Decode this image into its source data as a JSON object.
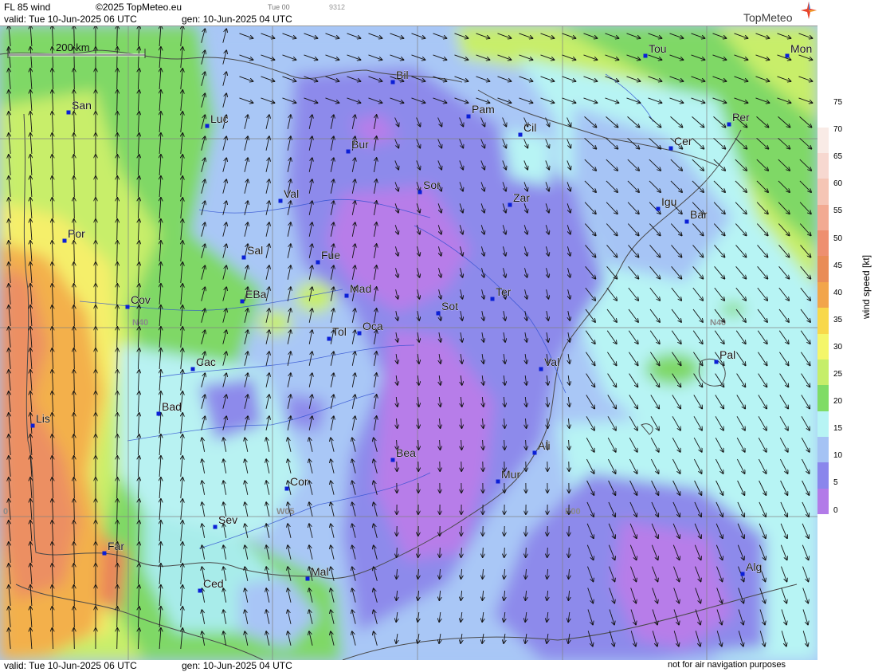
{
  "header": {
    "product": "FL 85 wind",
    "copyright": "©2025 TopMeteo.eu",
    "step_label": "Tue 00",
    "code": "9312",
    "valid": "valid:  Tue  10-Jun-2025  06 UTC",
    "generated": "gen: 10-Jun-2025 04 UTC",
    "brand": "TopMeteo"
  },
  "footer": {
    "valid": "valid:  Tue  10-Jun-2025  06 UTC",
    "generated": "gen: 10-Jun-2025 04 UTC",
    "disclaimer": "not for air navigation purposes"
  },
  "scale_bar": {
    "label": "200 km"
  },
  "grid_labels": {
    "lat_n40": "N40",
    "lon_w05": "W05",
    "lon_e00": "E00",
    "lon_w10": "0"
  },
  "legend": {
    "title": "wind speed  [kt]",
    "ticks": [
      "75",
      "70",
      "65",
      "60",
      "55",
      "50",
      "45",
      "40",
      "35",
      "30",
      "25",
      "20",
      "15",
      "10",
      "5",
      "0"
    ],
    "colors": [
      "#ffffff",
      "#ffffff",
      "#f9ebe6",
      "#f7d8d0",
      "#f5c5b5",
      "#f2aa92",
      "#ee8f6f",
      "#e98c56",
      "#f2a54a",
      "#f8d84a",
      "#f4f66a",
      "#c5ee6a",
      "#7fdc66",
      "#b7f4f4",
      "#a5c3f4",
      "#8a86ec",
      "#b27be8"
    ]
  },
  "cities": [
    {
      "name": "Bil"
    },
    {
      "name": "Tou"
    },
    {
      "name": "Mon"
    },
    {
      "name": "San"
    },
    {
      "name": "Luc"
    },
    {
      "name": "Pam"
    },
    {
      "name": "Cil"
    },
    {
      "name": "Per"
    },
    {
      "name": "Bur"
    },
    {
      "name": "Cer"
    },
    {
      "name": "Sor"
    },
    {
      "name": "Val"
    },
    {
      "name": "Zar"
    },
    {
      "name": "Igu"
    },
    {
      "name": "Bar"
    },
    {
      "name": "Por"
    },
    {
      "name": "Sal"
    },
    {
      "name": "Fue"
    },
    {
      "name": "Mad"
    },
    {
      "name": "Cov"
    },
    {
      "name": "EBa"
    },
    {
      "name": "Ter"
    },
    {
      "name": "Sot"
    },
    {
      "name": "Tol"
    },
    {
      "name": "Oca"
    },
    {
      "name": "Pal"
    },
    {
      "name": "Cac"
    },
    {
      "name": "Val"
    },
    {
      "name": "Bad"
    },
    {
      "name": "Lis"
    },
    {
      "name": "Bea"
    },
    {
      "name": "Ali"
    },
    {
      "name": "Mur"
    },
    {
      "name": "Cor"
    },
    {
      "name": "Sev"
    },
    {
      "name": "Far"
    },
    {
      "name": "Mal"
    },
    {
      "name": "Alg"
    },
    {
      "name": "Ced"
    }
  ],
  "colors": {
    "city_marker": "#0b1fd6",
    "background_field": "#a7c6f5"
  }
}
